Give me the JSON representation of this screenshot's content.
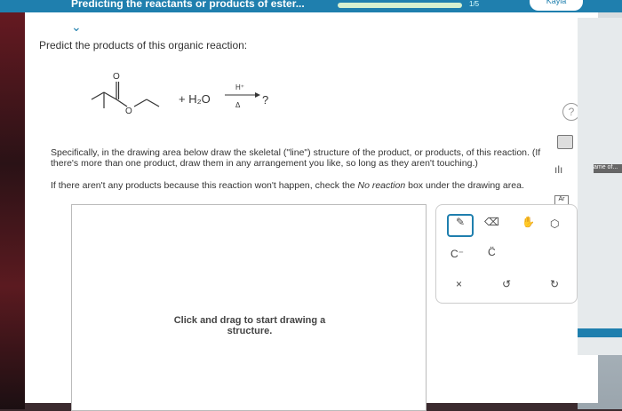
{
  "topbar": {
    "title": "Predicting the reactants or products of ester...",
    "counter": "1/5",
    "user_label": "Kayla"
  },
  "question": {
    "prompt": "Predict the products of this organic reaction:",
    "plus_text": "+ H₂O",
    "arrow_top": "H⁺",
    "arrow_bottom": "Δ",
    "product_placeholder": "?"
  },
  "instructions": {
    "line1": "Specifically, in the drawing area below draw the skeletal (\"line\") structure of the product, or products, of this reaction. (If there's more than one product, draw them in any arrangement you like, so long as they aren't touching.)",
    "line2_prefix": "If there aren't any products because this reaction won't happen, check the ",
    "line2_italic": "No reaction",
    "line2_suffix": " box under the drawing area."
  },
  "drawing_area": {
    "hint": "Click and drag to start drawing a structure."
  },
  "toolbox": {
    "c_minus": "C⁻",
    "c_dots": "C̈"
  },
  "side": {
    "help": "?",
    "ar": "Ar"
  },
  "strip": {
    "badge": "ame of..."
  }
}
